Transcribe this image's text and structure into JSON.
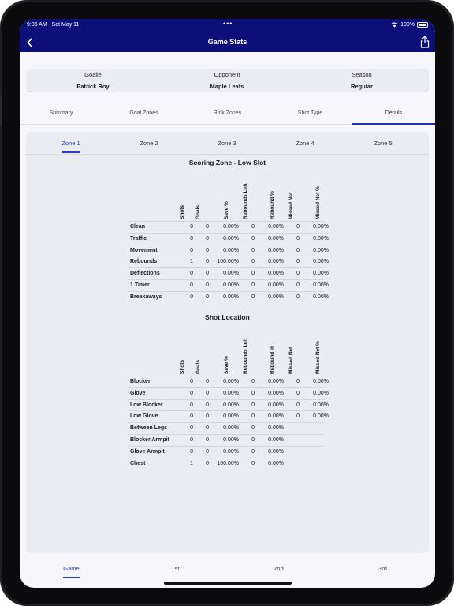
{
  "status_bar": {
    "time": "9:36 AM",
    "date": "Sat May 11",
    "battery": "100%"
  },
  "navbar": {
    "title": "Game Stats",
    "back_icon": "chevron-left-icon",
    "share_icon": "share-icon"
  },
  "filters": [
    {
      "label": "Goalie",
      "value": "Patrick Roy"
    },
    {
      "label": "Opponent",
      "value": "Maple Leafs"
    },
    {
      "label": "Season",
      "value": "Regular"
    }
  ],
  "tabs": [
    "Summary",
    "Goal Zones",
    "Rink Zones",
    "Shot Type",
    "Details"
  ],
  "active_tab": "Details",
  "zone_tabs": [
    "Zone 1",
    "Zone 2",
    "Zone 3",
    "Zone 4",
    "Zone 5"
  ],
  "active_zone": "Zone 1",
  "columns": [
    "Shots",
    "Goals",
    "Save %",
    "Rebounds Left",
    "Rebound %",
    "Missed Net",
    "Missed Net %"
  ],
  "scoring_zone": {
    "title": "Scoring Zone - Low Slot",
    "rows": [
      {
        "name": "Clean",
        "values": [
          "0",
          "0",
          "0.00%",
          "0",
          "0.00%",
          "0",
          "0.00%"
        ]
      },
      {
        "name": "Traffic",
        "values": [
          "0",
          "0",
          "0.00%",
          "0",
          "0.00%",
          "0",
          "0.00%"
        ]
      },
      {
        "name": "Movement",
        "values": [
          "0",
          "0",
          "0.00%",
          "0",
          "0.00%",
          "0",
          "0.00%"
        ]
      },
      {
        "name": "Rebounds",
        "values": [
          "1",
          "0",
          "100.00%",
          "0",
          "0.00%",
          "0",
          "0.00%"
        ]
      },
      {
        "name": "Deflections",
        "values": [
          "0",
          "0",
          "0.00%",
          "0",
          "0.00%",
          "0",
          "0.00%"
        ]
      },
      {
        "name": "1 Timer",
        "values": [
          "0",
          "0",
          "0.00%",
          "0",
          "0.00%",
          "0",
          "0.00%"
        ]
      },
      {
        "name": "Breakaways",
        "values": [
          "0",
          "0",
          "0.00%",
          "0",
          "0.00%",
          "0",
          "0.00%"
        ]
      }
    ]
  },
  "shot_location": {
    "title": "Shot Location",
    "rows": [
      {
        "name": "Blocker",
        "values": [
          "0",
          "0",
          "0.00%",
          "0",
          "0.00%",
          "0",
          "0.00%"
        ]
      },
      {
        "name": "Glove",
        "values": [
          "0",
          "0",
          "0.00%",
          "0",
          "0.00%",
          "0",
          "0.00%"
        ]
      },
      {
        "name": "Low Blocker",
        "values": [
          "0",
          "0",
          "0.00%",
          "0",
          "0.00%",
          "0",
          "0.00%"
        ]
      },
      {
        "name": "Low Glove",
        "values": [
          "0",
          "0",
          "0.00%",
          "0",
          "0.00%",
          "0",
          "0.00%"
        ]
      },
      {
        "name": "Between Legs",
        "values": [
          "0",
          "0",
          "0.00%",
          "0",
          "0.00%",
          "",
          ""
        ]
      },
      {
        "name": "Blocker Armpit",
        "values": [
          "0",
          "0",
          "0.00%",
          "0",
          "0.00%",
          "",
          ""
        ]
      },
      {
        "name": "Glove Armpit",
        "values": [
          "0",
          "0",
          "0.00%",
          "0",
          "0.00%",
          "",
          ""
        ]
      },
      {
        "name": "Chest",
        "values": [
          "1",
          "0",
          "100.00%",
          "0",
          "0.00%",
          "",
          ""
        ]
      }
    ]
  },
  "bottom_tabs": [
    "Game",
    "1st",
    "2nd",
    "3rd"
  ],
  "active_bottom_tab": "Game",
  "colors": {
    "nav": "#0c0e7a",
    "accent": "#2a3ad0",
    "panel": "#ebebf2"
  }
}
